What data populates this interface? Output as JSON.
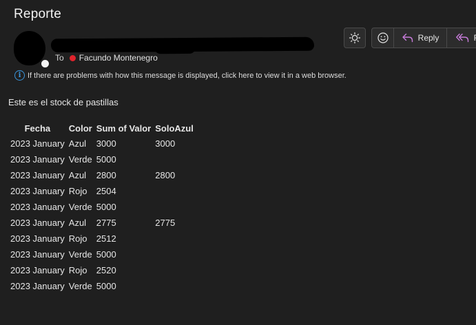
{
  "message": {
    "subject": "Reporte",
    "to_label": "To",
    "recipient": "Facundo Montenegro",
    "info_bar": "If there are problems with how this message is displayed, click here to view it in a web browser.",
    "body_intro": "Este es el stock de pastillas"
  },
  "toolbar": {
    "reply_label": "Reply",
    "reply_all_label": "R"
  },
  "table": {
    "headers": [
      "Fecha",
      "Color",
      "Sum of Valor",
      "SoloAzul"
    ],
    "rows": [
      [
        "2023 January",
        "Azul",
        "3000",
        "3000"
      ],
      [
        "2023 January",
        "Verde",
        "5000",
        ""
      ],
      [
        "2023 January",
        "Azul",
        "2800",
        "2800"
      ],
      [
        "2023 January",
        "Rojo",
        "2504",
        ""
      ],
      [
        "2023 January",
        "Verde",
        "5000",
        ""
      ],
      [
        "2023 January",
        "Azul",
        "2775",
        "2775"
      ],
      [
        "2023 January",
        "Rojo",
        "2512",
        ""
      ],
      [
        "2023 January",
        "Verde",
        "5000",
        ""
      ],
      [
        "2023 January",
        "Rojo",
        "2520",
        ""
      ],
      [
        "2023 January",
        "Verde",
        "5000",
        ""
      ]
    ]
  },
  "colors": {
    "background": "#1f1f1f",
    "presence_red": "#e0242c",
    "info_blue": "#3a96dd",
    "reply_icon": "#c67bd9"
  },
  "icons": {
    "theme": "sun-icon",
    "emoji": "smiley-icon",
    "reply": "reply-arrow-icon",
    "reply_all": "reply-all-arrow-icon",
    "info": "info-icon"
  }
}
